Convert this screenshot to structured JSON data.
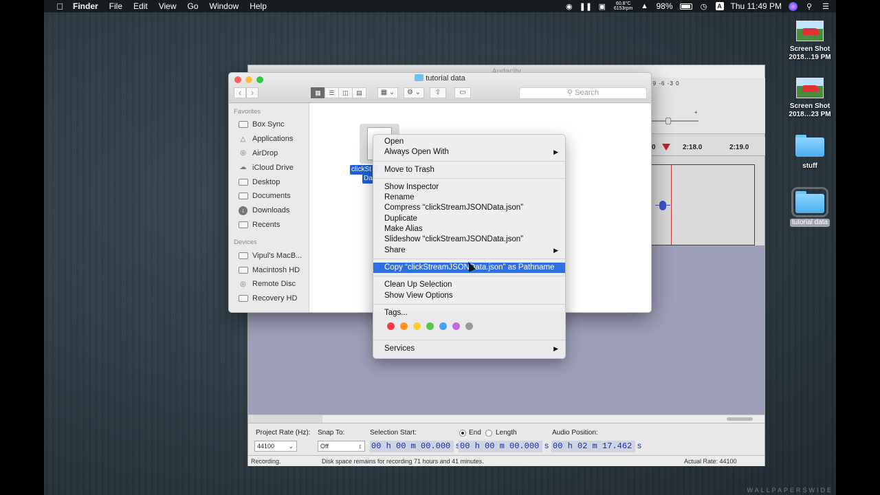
{
  "menubar": {
    "app": "Finder",
    "items": [
      "File",
      "Edit",
      "View",
      "Go",
      "Window",
      "Help"
    ],
    "temp": "60.8°C",
    "rpm": "6153rpm",
    "battery": "98%",
    "input_source": "A",
    "clock": "Thu 11:49 PM"
  },
  "desktop": {
    "icons": [
      {
        "label1": "Screen Shot",
        "label2": "2018…19 PM"
      },
      {
        "label1": "Screen Shot",
        "label2": "2018…23 PM"
      },
      {
        "label1": "stuff"
      },
      {
        "label1": "tutorial data"
      }
    ],
    "watermark": "WALLPAPERSWIDE"
  },
  "audacity": {
    "title": "Audacity",
    "meter_scale": "-9 -6 -3 0",
    "slider_minus": "-",
    "slider_plus": "+",
    "ruler": {
      "t1": "0",
      "t2": "2:18.0",
      "t3": "2:19.0"
    },
    "selection_bar": {
      "project_rate_label": "Project Rate (Hz):",
      "project_rate_value": "44100",
      "snap_to_label": "Snap To:",
      "snap_to_value": "Off",
      "selection_start_label": "Selection Start:",
      "end_label": "End",
      "length_label": "Length",
      "audio_position_label": "Audio Position:",
      "selection_start": "00 h 00 m 00.000 s",
      "selection_end": "00 h 00 m 00.000 s",
      "audio_position": "00 h 02 m 17.462 s"
    },
    "status": {
      "left": "Recording.",
      "middle": "Disk space remains for recording 71 hours and 41 minutes.",
      "right": "Actual Rate: 44100"
    }
  },
  "finder": {
    "title": "tutorial data",
    "search_placeholder": "Search",
    "sidebar": {
      "favorites_header": "Favorites",
      "favorites": [
        "Box Sync",
        "Applications",
        "AirDrop",
        "iCloud Drive",
        "Desktop",
        "Documents",
        "Downloads",
        "Recents"
      ],
      "devices_header": "Devices",
      "devices": [
        "Vipul's MacB...",
        "Macintosh HD",
        "Remote Disc",
        "Recovery HD"
      ]
    },
    "file": {
      "label_line1": "clickSt",
      "label_line2": "Da"
    }
  },
  "context_menu": {
    "group1": [
      "Open",
      "Always Open With"
    ],
    "group2": [
      "Move to Trash"
    ],
    "group3": [
      "Show Inspector",
      "Rename",
      "Compress “clickStreamJSONData.json”",
      "Duplicate",
      "Make Alias",
      "Slideshow “clickStreamJSONData.json”",
      "Share"
    ],
    "highlighted": "Copy “clickStreamJSONData.json” as Pathname",
    "group5": [
      "Clean Up Selection",
      "Show View Options"
    ],
    "tags_label": "Tags...",
    "tag_colors": [
      "#fc3b3f",
      "#fd9426",
      "#fecb2f",
      "#57c84d",
      "#3fa5f5",
      "#c069e0",
      "#9a9a9a"
    ],
    "services": "Services"
  }
}
